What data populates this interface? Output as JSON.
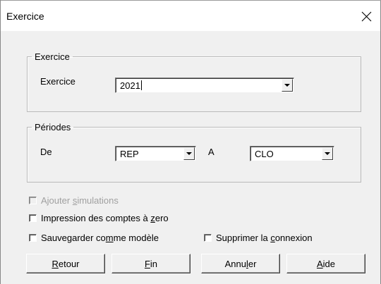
{
  "window": {
    "title": "Exercice",
    "close_icon": "close-icon"
  },
  "exercice_group": {
    "legend": "Exercice",
    "field_label": "Exercice",
    "value": "2021"
  },
  "periodes_group": {
    "legend": "Périodes",
    "from_label": "De",
    "from_value": "REP",
    "to_label": "A",
    "to_value": "CLO"
  },
  "options": {
    "ajouter_simulations": {
      "pre": "Ajouter ",
      "u": "s",
      "post": "imulations",
      "checked": false,
      "enabled": false
    },
    "impression": {
      "pre": "Impression des comptes à ",
      "u": "z",
      "post": "ero",
      "checked": false,
      "enabled": true
    },
    "sauvegarder": {
      "pre": "Sauvegarder co",
      "u": "m",
      "post": "me modèle",
      "checked": false,
      "enabled": true
    },
    "supprimer": {
      "pre": "Supprimer la ",
      "u": "c",
      "post": "onnexion",
      "checked": false,
      "enabled": true
    }
  },
  "buttons": {
    "retour": {
      "u": "R",
      "post": "etour"
    },
    "fin": {
      "u": "F",
      "post": "in"
    },
    "annuler": {
      "pre": "Annu",
      "u": "l",
      "post": "er"
    },
    "aide": {
      "u": "A",
      "post": "ide"
    }
  }
}
